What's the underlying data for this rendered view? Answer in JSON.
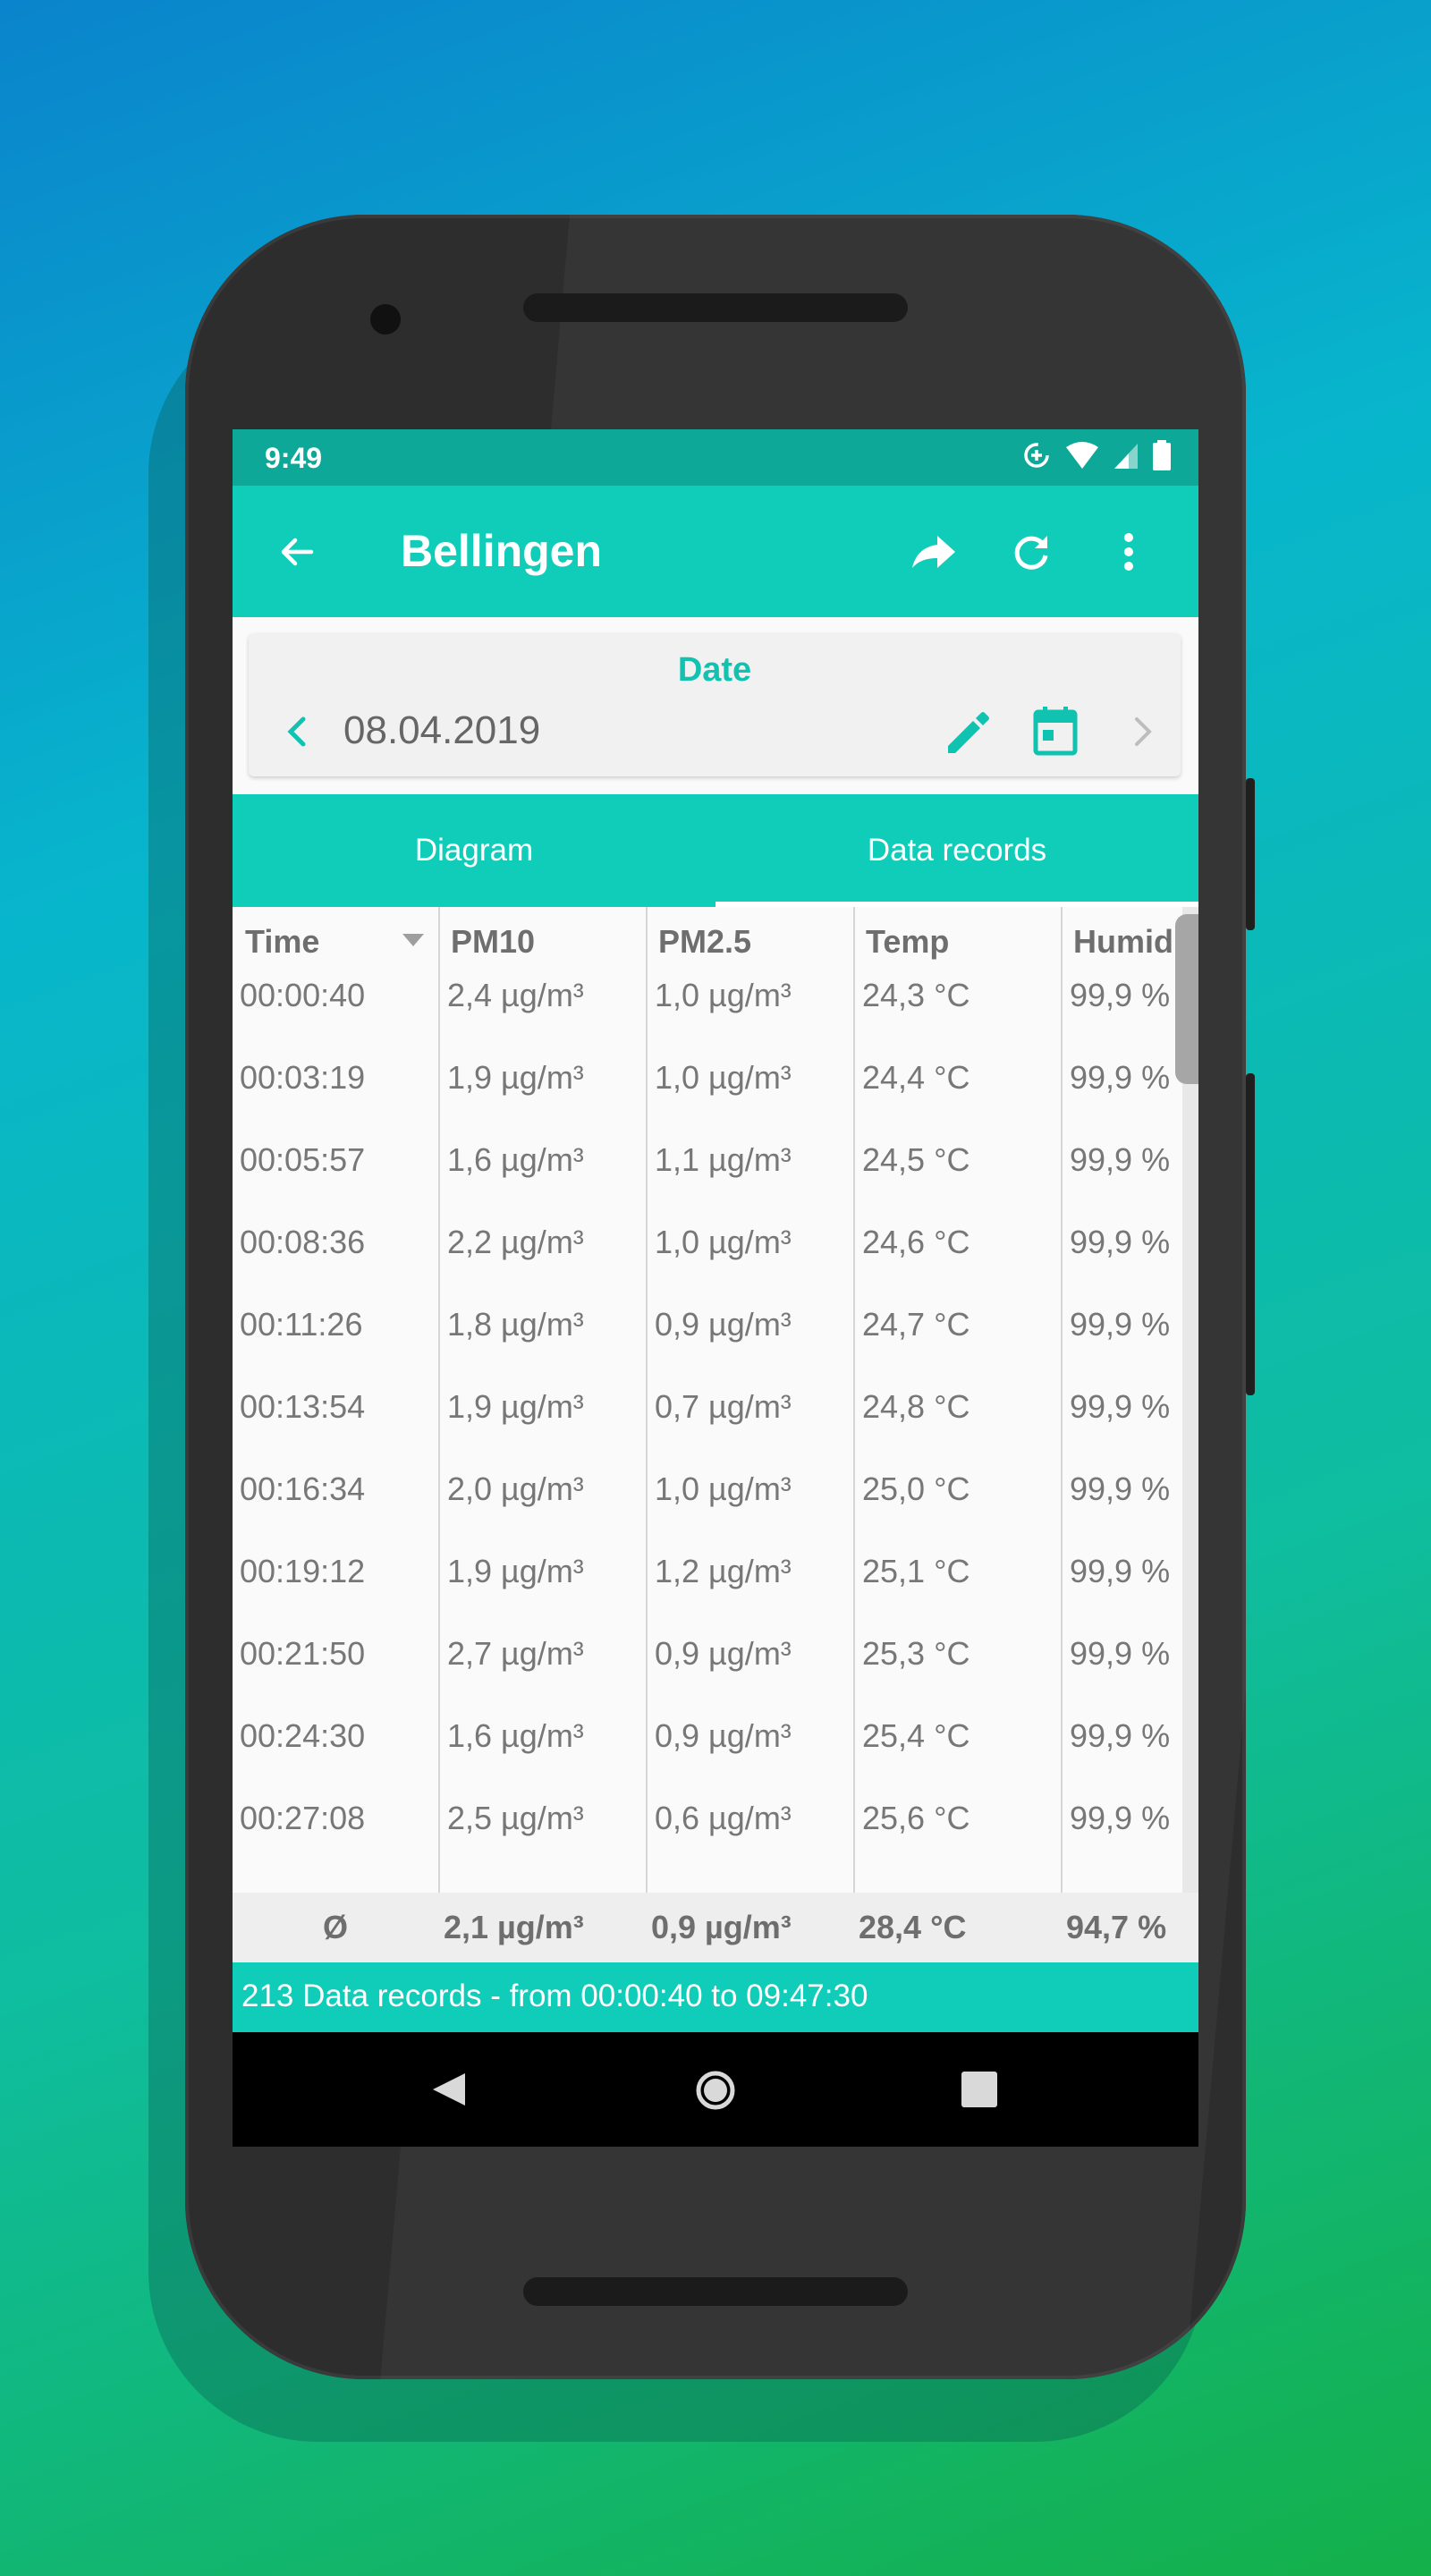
{
  "status_bar": {
    "time": "9:49"
  },
  "app_bar": {
    "title": "Bellingen"
  },
  "date_card": {
    "label": "Date",
    "value": "08.04.2019"
  },
  "tabs": [
    {
      "label": "Diagram"
    },
    {
      "label": "Data records",
      "selected": true
    }
  ],
  "table": {
    "headers": [
      "Time",
      "PM10",
      "PM2.5",
      "Temp",
      "Humidi"
    ],
    "rows": [
      [
        "00:00:40",
        "2,4 µg/m³",
        "1,0 µg/m³",
        "24,3 °C",
        "99,9 %"
      ],
      [
        "00:03:19",
        "1,9 µg/m³",
        "1,0 µg/m³",
        "24,4 °C",
        "99,9 %"
      ],
      [
        "00:05:57",
        "1,6 µg/m³",
        "1,1 µg/m³",
        "24,5 °C",
        "99,9 %"
      ],
      [
        "00:08:36",
        "2,2 µg/m³",
        "1,0 µg/m³",
        "24,6 °C",
        "99,9 %"
      ],
      [
        "00:11:26",
        "1,8 µg/m³",
        "0,9 µg/m³",
        "24,7 °C",
        "99,9 %"
      ],
      [
        "00:13:54",
        "1,9 µg/m³",
        "0,7 µg/m³",
        "24,8 °C",
        "99,9 %"
      ],
      [
        "00:16:34",
        "2,0 µg/m³",
        "1,0 µg/m³",
        "25,0 °C",
        "99,9 %"
      ],
      [
        "00:19:12",
        "1,9 µg/m³",
        "1,2 µg/m³",
        "25,1 °C",
        "99,9 %"
      ],
      [
        "00:21:50",
        "2,7 µg/m³",
        "0,9 µg/m³",
        "25,3 °C",
        "99,9 %"
      ],
      [
        "00:24:30",
        "1,6 µg/m³",
        "0,9 µg/m³",
        "25,4 °C",
        "99,9 %"
      ],
      [
        "00:27:08",
        "2,5 µg/m³",
        "0,6 µg/m³",
        "25,6 °C",
        "99,9 %"
      ]
    ],
    "average": [
      "Ø",
      "2,1 µg/m³",
      "0,9 µg/m³",
      "28,4 °C",
      "94,7 %"
    ]
  },
  "footer": {
    "text": "213 Data records - from 00:00:40 to 09:47:30"
  },
  "colors": {
    "accent": "#10cdb9",
    "status_bar": "#0ea899",
    "date_label": "#10c2b0"
  }
}
